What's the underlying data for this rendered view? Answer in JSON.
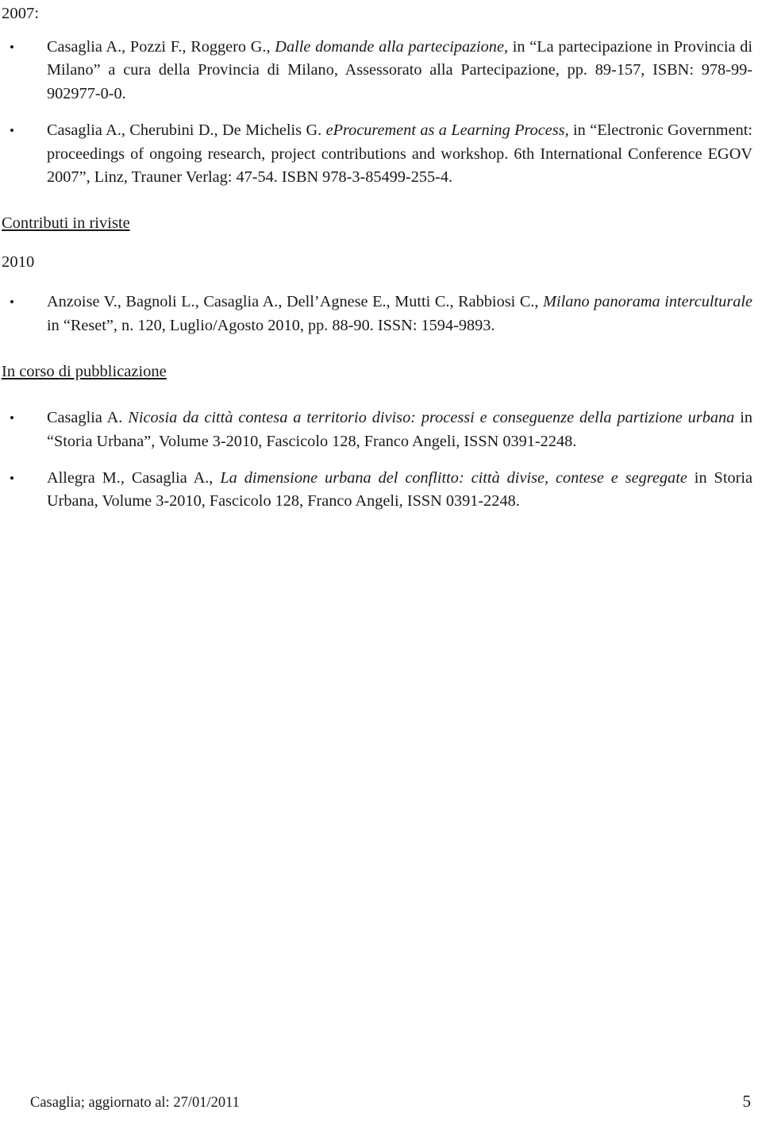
{
  "document": {
    "year_heading": "2007:",
    "sections": [
      {
        "id": "libri-2007",
        "heading": null,
        "subheading": null,
        "entries": [
          {
            "parts": [
              {
                "text": "Casaglia A., Pozzi F., Roggero G., ",
                "style": "normal"
              },
              {
                "text": "Dalle domande alla partecipazione",
                "style": "italic"
              },
              {
                "text": ", in “La partecipazione in Provincia di Milano” a cura della Provincia di Milano, Assessorato alla Partecipazione, pp. 89-157, ISBN: 978-99-902977-0-0.",
                "style": "normal"
              }
            ]
          },
          {
            "parts": [
              {
                "text": "Casaglia A., Cherubini D., De Michelis G. ",
                "style": "normal"
              },
              {
                "text": "eProcurement as a Learning Process",
                "style": "italic"
              },
              {
                "text": ", in “Electronic Government: proceedings of ongoing research, project contributions and workshop. 6th International Conference EGOV 2007”, Linz, Trauner Verlag: 47-54. ISBN 978-3-85499-255-4.",
                "style": "normal"
              }
            ]
          }
        ]
      },
      {
        "id": "contributi-in-riviste",
        "heading": "Contributi in riviste",
        "subheading": "2010",
        "entries": [
          {
            "parts": [
              {
                "text": "Anzoise V., Bagnoli L., Casaglia A., Dell’Agnese E., Mutti C., Rabbiosi C., ",
                "style": "normal"
              },
              {
                "text": "Milano panorama interculturale",
                "style": "italic"
              },
              {
                "text": " in “Reset”, n. 120, Luglio/Agosto 2010, pp. 88-90. ISSN: 1594-9893.",
                "style": "normal"
              }
            ]
          }
        ]
      },
      {
        "id": "in-corso-di-pubblicazione",
        "heading": "In corso di pubblicazione",
        "subheading": null,
        "entries": [
          {
            "parts": [
              {
                "text": "Casaglia A. ",
                "style": "normal"
              },
              {
                "text": "Nicosia da città contesa a territorio diviso: processi e conseguenze della partizione urbana",
                "style": "italic"
              },
              {
                "text": " in “Storia Urbana”, Volume 3-2010, Fascicolo 128, Franco Angeli, ISSN 0391-2248.",
                "style": "normal"
              }
            ]
          },
          {
            "parts": [
              {
                "text": "Allegra M., Casaglia A., ",
                "style": "normal"
              },
              {
                "text": "La dimensione urbana del conflitto: città divise, contese e segregate",
                "style": "italic"
              },
              {
                "text": " in Storia Urbana, Volume 3-2010, Fascicolo 128, Franco Angeli, ISSN 0391-2248.",
                "style": "normal"
              }
            ]
          }
        ]
      }
    ]
  },
  "footer": {
    "left_text": "Casaglia; aggiornato al: 27/01/2011",
    "page_number": "5"
  },
  "colors": {
    "page_background": "#ffffff",
    "text": "#1a1a1a"
  }
}
